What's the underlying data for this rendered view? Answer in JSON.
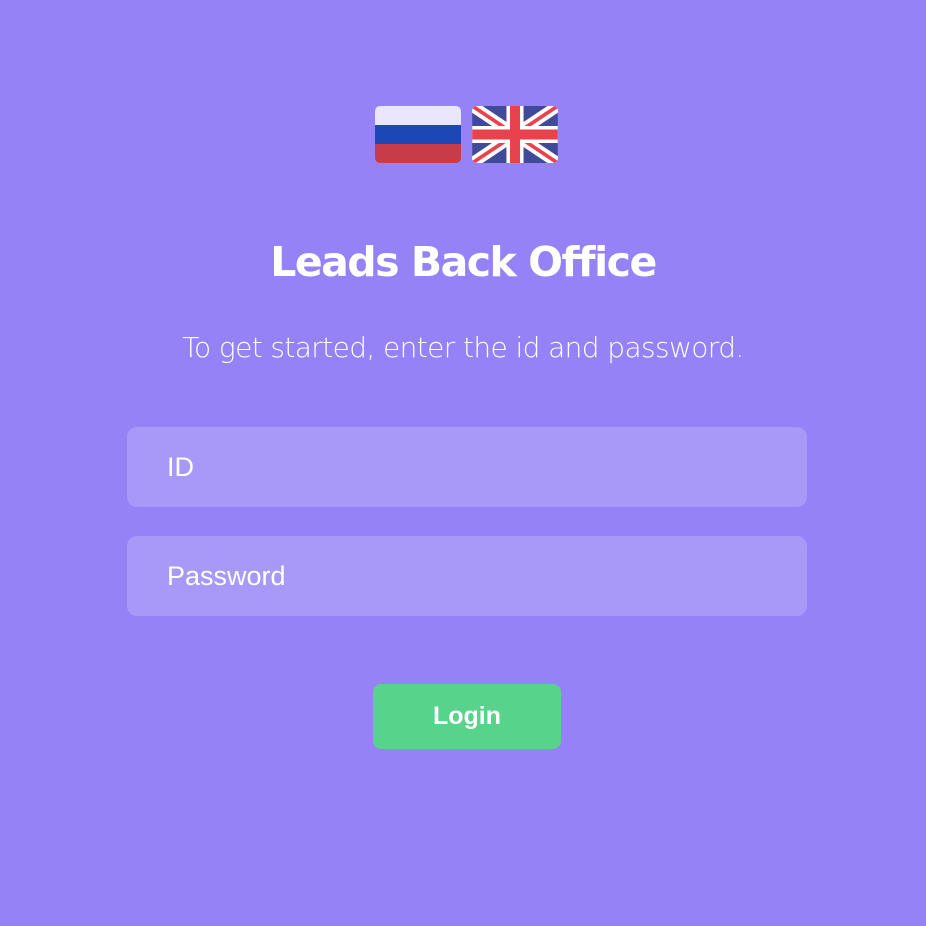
{
  "language_switcher": {
    "items": [
      {
        "icon": "russia-flag-icon",
        "colors": [
          "#ffffff",
          "#0039a6",
          "#d52b1e"
        ]
      },
      {
        "icon": "uk-flag-icon",
        "colors": [
          "#012169",
          "#ffffff",
          "#c8102e"
        ]
      }
    ]
  },
  "header": {
    "title": "Leads Back Office",
    "subtitle": "To get started, enter the id and password."
  },
  "form": {
    "id_field": {
      "placeholder": "ID",
      "value": ""
    },
    "password_field": {
      "placeholder": "Password",
      "value": ""
    },
    "login_label": "Login"
  },
  "colors": {
    "background": "#9582f7",
    "field_background": "#a796f9",
    "button": "#57d38c",
    "text": "#ffffff"
  }
}
